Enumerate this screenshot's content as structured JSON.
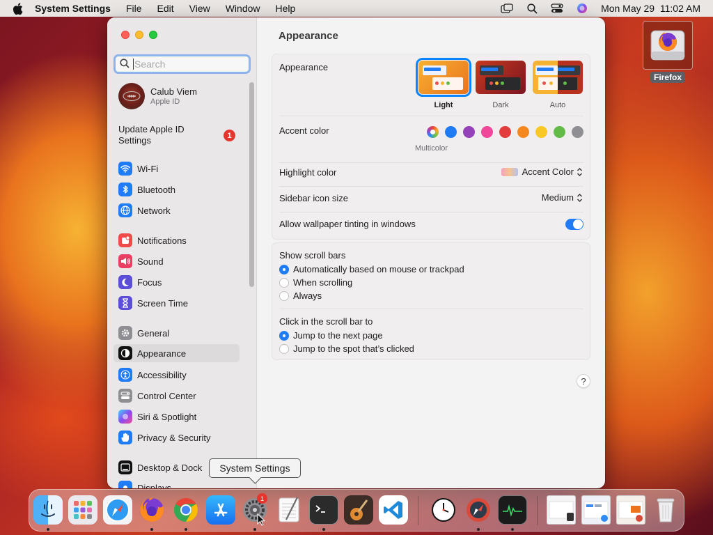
{
  "menubar": {
    "app_name": "System Settings",
    "menus": [
      "File",
      "Edit",
      "View",
      "Window",
      "Help"
    ],
    "datetime": "Mon May 29  11:02 AM"
  },
  "desktop": {
    "firefox_label": "Firefox"
  },
  "sidebar": {
    "search_placeholder": "Search",
    "profile": {
      "name": "Calub Viem",
      "subtitle": "Apple ID"
    },
    "update": {
      "label": "Update Apple ID Settings",
      "badge": "1"
    },
    "items": [
      {
        "label": "Wi-Fi",
        "icon": "wifi-icon",
        "color": "#1f7cf5"
      },
      {
        "label": "Bluetooth",
        "icon": "bluetooth-icon",
        "color": "#1f7cf5"
      },
      {
        "label": "Network",
        "icon": "globe-icon",
        "color": "#1f7cf5"
      },
      {
        "label": "Notifications",
        "icon": "bell-icon",
        "color": "#ef4b4b"
      },
      {
        "label": "Sound",
        "icon": "speaker-icon",
        "color": "#ee3d63"
      },
      {
        "label": "Focus",
        "icon": "moon-icon",
        "color": "#5c4ed8"
      },
      {
        "label": "Screen Time",
        "icon": "hourglass-icon",
        "color": "#5c4ed8"
      },
      {
        "label": "General",
        "icon": "gear-icon",
        "color": "#8e8e93"
      },
      {
        "label": "Appearance",
        "icon": "appearance-icon",
        "color": "#111111"
      },
      {
        "label": "Accessibility",
        "icon": "accessibility-icon",
        "color": "#1f7cf5"
      },
      {
        "label": "Control Center",
        "icon": "control-center-icon",
        "color": "#8e8e93"
      },
      {
        "label": "Siri & Spotlight",
        "icon": "siri-icon",
        "color": "#c04ad8"
      },
      {
        "label": "Privacy & Security",
        "icon": "hand-icon",
        "color": "#1f7cf5"
      },
      {
        "label": "Desktop & Dock",
        "icon": "dock-icon",
        "color": "#111111"
      },
      {
        "label": "Displays",
        "icon": "display-icon",
        "color": "#1f7cf5"
      }
    ]
  },
  "content": {
    "title": "Appearance",
    "appearance": {
      "label": "Appearance",
      "options": [
        "Light",
        "Dark",
        "Auto"
      ],
      "selected": "Light"
    },
    "accent": {
      "label": "Accent color",
      "colors": [
        "#f5b52e",
        "#1f7cf5",
        "#9541b9",
        "#f0479b",
        "#e23c3c",
        "#f5871f",
        "#f9c826",
        "#61bb46",
        "#8e8e93"
      ],
      "selected_name": "Multicolor"
    },
    "highlight": {
      "label": "Highlight color",
      "value": "Accent Color"
    },
    "icon_size": {
      "label": "Sidebar icon size",
      "value": "Medium"
    },
    "tinting": {
      "label": "Allow wallpaper tinting in windows",
      "on": true
    },
    "scroll_bars": {
      "label": "Show scroll bars",
      "options": [
        "Automatically based on mouse or trackpad",
        "When scrolling",
        "Always"
      ],
      "selected": 0
    },
    "click_scroll": {
      "label": "Click in the scroll bar to",
      "options": [
        "Jump to the next page",
        "Jump to the spot that’s clicked"
      ],
      "selected": 0
    },
    "help": "?"
  },
  "tooltip": "System Settings",
  "dock": {
    "apps": [
      "Finder",
      "Launchpad",
      "Safari",
      "Firefox",
      "Google Chrome",
      "App Store",
      "System Settings",
      "TextEdit",
      "Terminal",
      "GarageBand",
      "Visual Studio Code"
    ],
    "settings_badge": "1"
  }
}
